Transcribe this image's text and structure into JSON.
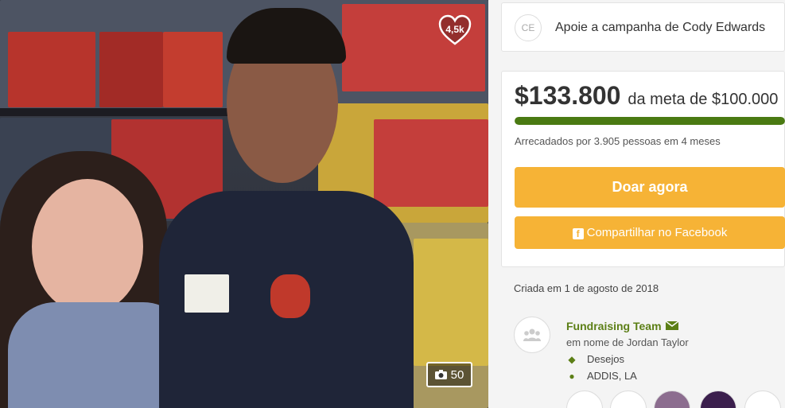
{
  "photo": {
    "likes": "4,5k",
    "photo_count": "50"
  },
  "support": {
    "avatar_initials": "CE",
    "text": "Apoie a campanha de Cody Edwards"
  },
  "goal": {
    "raised": "$133.800",
    "of_goal": "da meta de $100.000",
    "progress_fraction": 1.0,
    "raised_by": "Arrecadados por 3.905 pessoas em 4 meses",
    "donate_label": "Doar agora",
    "share_label": "Compartilhar no Facebook"
  },
  "created": "Criada em 1 de agosto de 2018",
  "organizer": {
    "name": "Fundraising Team",
    "behalf": "em nome de Jordan Taylor",
    "category": "Desejos",
    "location": "ADDIS, LA"
  },
  "colors": {
    "accent_orange": "#f6b336",
    "progress_green": "#4a7a12",
    "link_green": "#5c7f16"
  },
  "icons": [
    "heart-icon",
    "camera-icon",
    "facebook-icon",
    "mail-icon",
    "tag-icon",
    "location-pin-icon",
    "people-icon"
  ]
}
